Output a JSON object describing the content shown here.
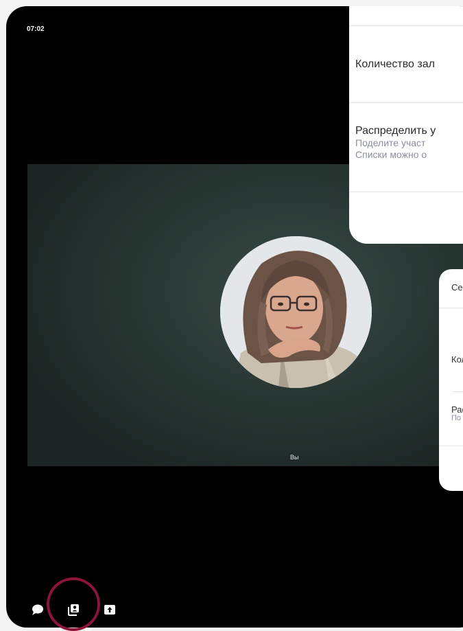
{
  "status_bar": {
    "time": "07:02"
  },
  "video_tile": {
    "participant_label": "Вы",
    "background_color": "#2e3d39"
  },
  "breakout_panel_main": {
    "rooms_count_label": "Количество зал",
    "distribute_title": "Распределить у",
    "distribute_desc_line1": "Поделите участ",
    "distribute_desc_line2": "Списки можно о"
  },
  "breakout_panel_secondary": {
    "header": "Сес",
    "rooms_count_label": "Кол",
    "distribute_title": "Рас",
    "distribute_desc": "По"
  },
  "toolbar": {
    "chat_icon": "chat-bubble-icon",
    "participants_icon": "participants-icon",
    "share_icon": "share-upload-icon",
    "highlight_color": "#8a1538"
  }
}
